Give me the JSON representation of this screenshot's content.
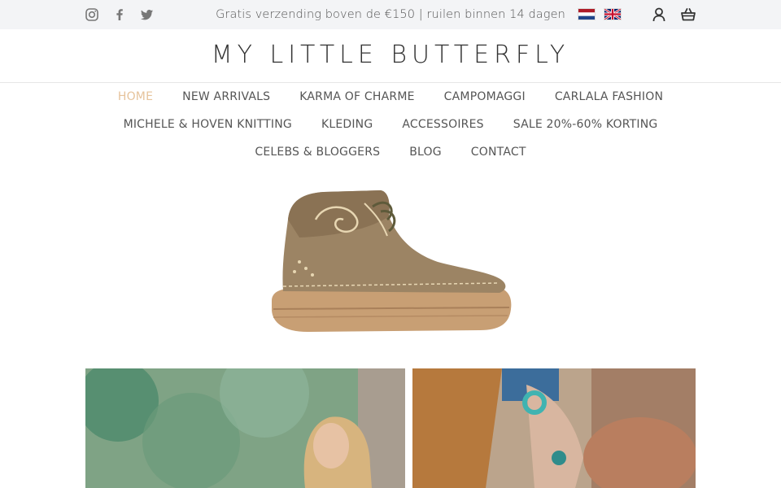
{
  "topbar": {
    "promo_text": "Gratis verzending boven de €150 | ruilen binnen 14 dagen",
    "social_icons": [
      "instagram-icon",
      "facebook-icon",
      "twitter-icon"
    ],
    "languages": [
      "nl-flag",
      "uk-flag"
    ],
    "tools": [
      "account-icon",
      "cart-icon"
    ]
  },
  "header": {
    "logo_text": "MY LITTLE BUTTERFLY"
  },
  "nav": {
    "active_color": "#e6c39b",
    "rows": [
      [
        "HOME",
        "NEW ARRIVALS",
        "KARMA OF CHARME",
        "CAMPOMAGGI",
        "CARLALA FASHION"
      ],
      [
        "MICHELE & HOVEN KNITTING",
        "KLEDING",
        "ACCESSOIRES",
        "SALE 20%-60% KORTING"
      ],
      [
        "CELEBS & BLOGGERS",
        "BLOG",
        "CONTACT"
      ]
    ]
  },
  "hero": {
    "image": "suede-sneaker-boot"
  },
  "tiles": [
    {
      "image": "woman-blonde-hair-garden"
    },
    {
      "image": "hands-turquoise-jewelry"
    }
  ]
}
